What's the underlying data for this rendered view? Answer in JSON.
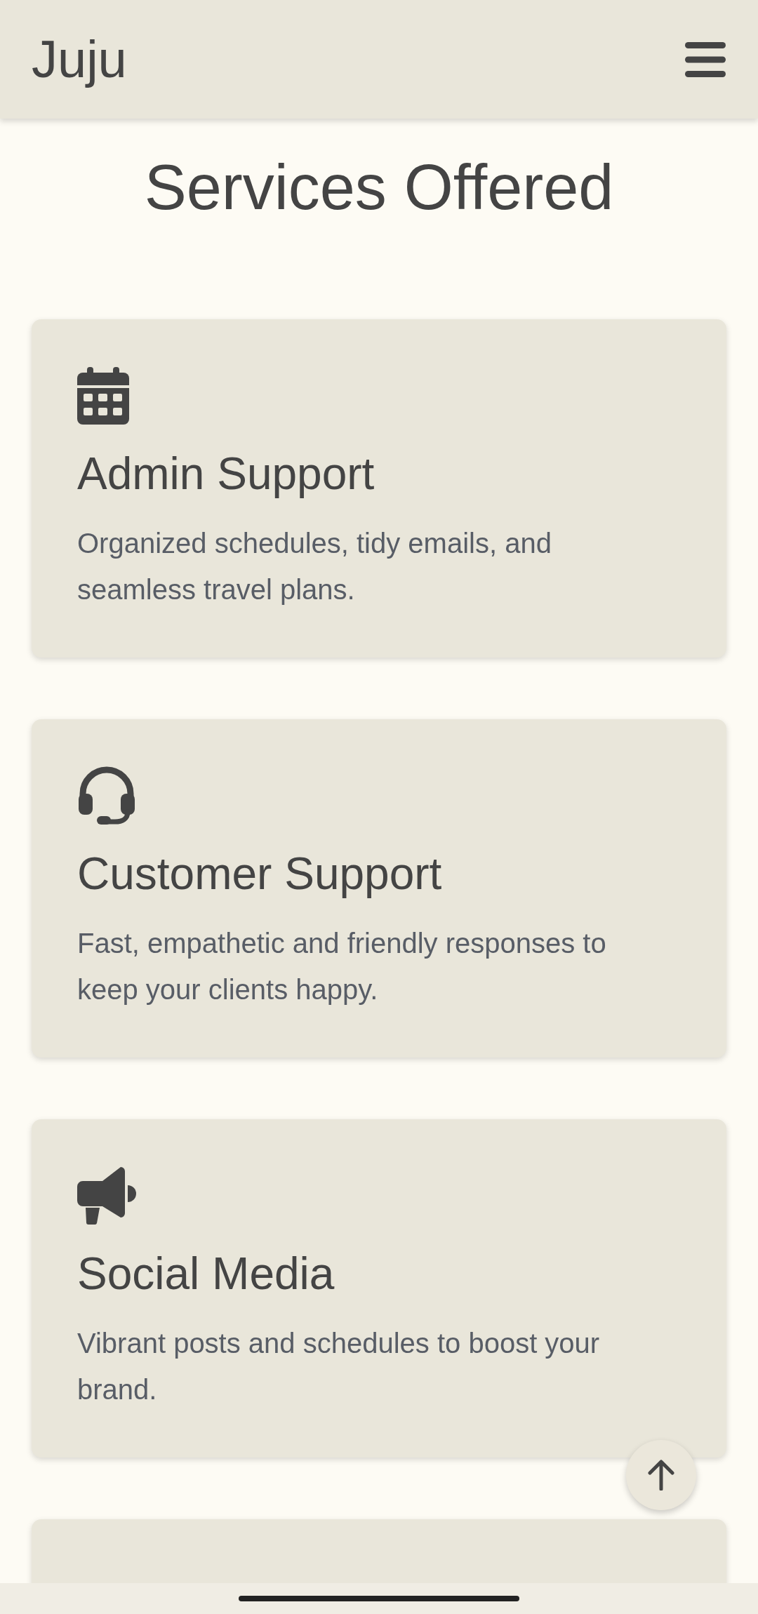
{
  "header": {
    "logo": "Juju"
  },
  "title": "Services Offered",
  "services": [
    {
      "kind": "calendar",
      "title": "Admin Support",
      "description": "Organized schedules, tidy emails, and seamless travel plans."
    },
    {
      "kind": "headset",
      "title": "Customer Support",
      "description": "Fast, empathetic and friendly responses to keep your clients happy."
    },
    {
      "kind": "megaphone",
      "title": "Social Media",
      "description": "Vibrant posts and schedules to boost your brand."
    }
  ]
}
